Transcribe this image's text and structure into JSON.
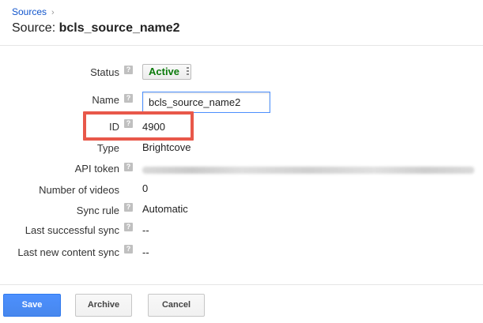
{
  "breadcrumb": {
    "parent": "Sources",
    "separator": "›"
  },
  "header": {
    "prefix": "Source: ",
    "name": "bcls_source_name2"
  },
  "help_glyph": "?",
  "fields": {
    "status": {
      "label": "Status",
      "value": "Active"
    },
    "name": {
      "label": "Name",
      "value": "bcls_source_name2"
    },
    "id": {
      "label": "ID",
      "value": "4900"
    },
    "type": {
      "label": "Type",
      "value": "Brightcove"
    },
    "api_token": {
      "label": "API token"
    },
    "number_of_videos": {
      "label": "Number of videos",
      "value": "0"
    },
    "sync_rule": {
      "label": "Sync rule",
      "value": "Automatic"
    },
    "last_successful_sync": {
      "label": "Last successful sync",
      "value": "--"
    },
    "last_new_content_sync": {
      "label": "Last new content sync",
      "value": "--"
    }
  },
  "actions": {
    "save": "Save",
    "archive": "Archive",
    "cancel": "Cancel"
  },
  "colors": {
    "link": "#1155cc",
    "active_status": "#0b7a0b",
    "highlight": "#e8584a",
    "primary": "#4d90fe"
  }
}
